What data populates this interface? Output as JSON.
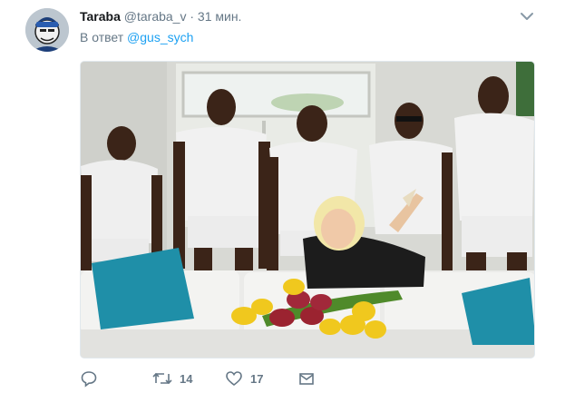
{
  "tweet": {
    "author": {
      "display_name": "Taraba",
      "screen_name": "@taraba_v",
      "separator": "·",
      "timestamp": "31 мин."
    },
    "reply": {
      "prefix": "В ответ",
      "mention": "@gus_sych"
    },
    "media": {
      "description_icon": "photo"
    },
    "actions": {
      "reply_icon": "reply-icon",
      "retweet_icon": "retweet-icon",
      "retweet_count": "14",
      "like_icon": "heart-icon",
      "like_count": "17",
      "dm_icon": "envelope-icon"
    }
  },
  "colors": {
    "text": "#14171a",
    "muted": "#657786",
    "link": "#1da1f2",
    "border": "#e1e8ed"
  }
}
